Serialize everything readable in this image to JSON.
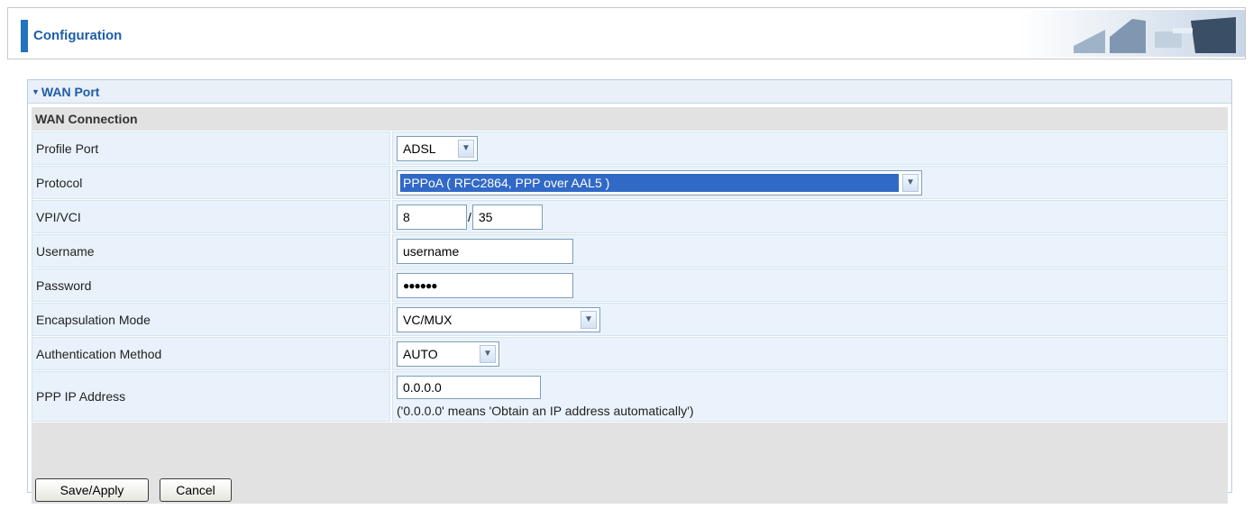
{
  "header": {
    "title": "Configuration"
  },
  "panel": {
    "title": "WAN Port"
  },
  "section": {
    "title": "WAN Connection"
  },
  "fields": {
    "profile_port": {
      "label": "Profile Port",
      "value": "ADSL"
    },
    "protocol": {
      "label": "Protocol",
      "value": "PPPoA ( RFC2864, PPP over AAL5 )"
    },
    "vpi_vci": {
      "label": "VPI/VCI",
      "vpi": "8",
      "separator": "/",
      "vci": "35"
    },
    "username": {
      "label": "Username",
      "value": "username"
    },
    "password": {
      "label": "Password",
      "value": "●●●●●●"
    },
    "encapsulation": {
      "label": "Encapsulation Mode",
      "value": "VC/MUX"
    },
    "auth": {
      "label": "Authentication Method",
      "value": "AUTO"
    },
    "ppp_ip": {
      "label": "PPP IP Address",
      "value": "0.0.0.0",
      "hint": "('0.0.0.0' means 'Obtain an IP address automatically')"
    }
  },
  "buttons": {
    "save": "Save/Apply",
    "cancel": "Cancel"
  },
  "icons": {
    "expand": "triangle-down-icon",
    "dropdown": "chevron-down-icon"
  },
  "colors": {
    "accent": "#1f73c1",
    "title": "#1f5da8",
    "selection": "#3169c6"
  }
}
